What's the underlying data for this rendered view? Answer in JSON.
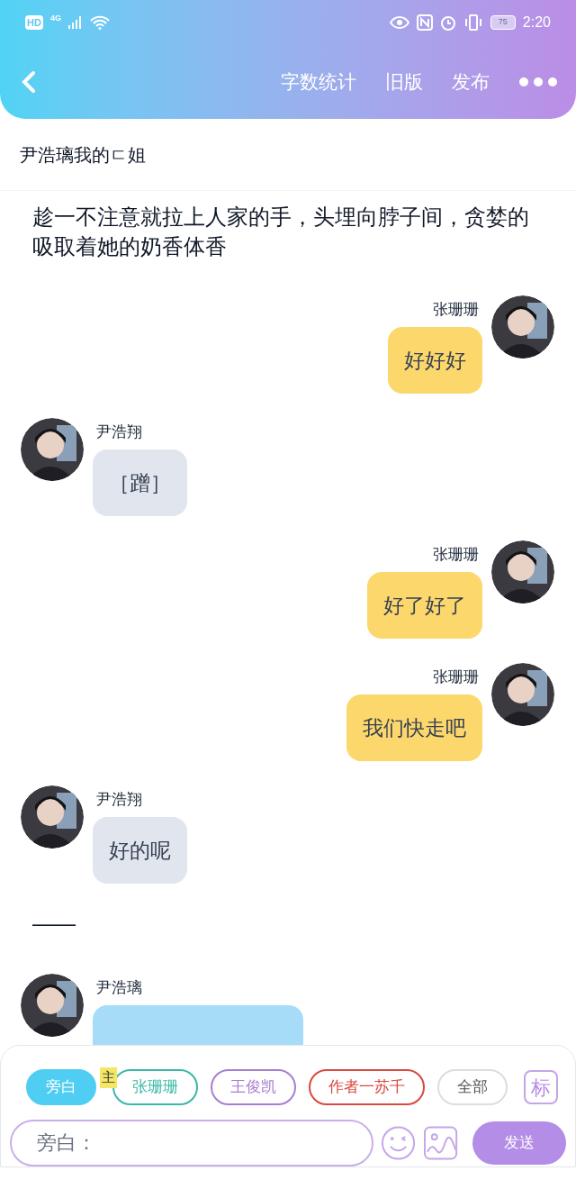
{
  "status_bar": {
    "hd": "HD",
    "network": "4G",
    "battery": "75",
    "time": "2:20"
  },
  "header": {
    "actions": [
      "字数统计",
      "旧版",
      "发布"
    ]
  },
  "chapter_title": "尹浩璃我的ㄷ姐",
  "messages": [
    {
      "kind": "narration",
      "text": "趁一不注意就拉上人家的手，头埋向脖子间，贪婪的吸取着她的奶香体香"
    },
    {
      "kind": "right",
      "speaker": "张珊珊",
      "text": "好好好",
      "color": "#fcd76b"
    },
    {
      "kind": "left",
      "speaker": "尹浩翔",
      "text": "［蹭］",
      "color": "#e1e6ee"
    },
    {
      "kind": "right",
      "speaker": "张珊珊",
      "text": "好了好了",
      "color": "#fcd76b"
    },
    {
      "kind": "right",
      "speaker": "张珊珊",
      "text": "我们快走吧",
      "color": "#fcd76b"
    },
    {
      "kind": "left",
      "speaker": "尹浩翔",
      "text": "好的呢",
      "color": "#e1e6ee"
    },
    {
      "kind": "narration",
      "text": "——"
    },
    {
      "kind": "left",
      "speaker": "尹浩璃",
      "color": "#a6dcf8"
    }
  ],
  "role_chips": [
    {
      "label": "旁白",
      "color": "#4fcdf2",
      "selected": true
    },
    {
      "label": "张珊珊",
      "color": "#3bb8a5",
      "selected": false,
      "badge": "主"
    },
    {
      "label": "王俊凯",
      "color": "#a87fd0",
      "selected": false
    },
    {
      "label": "作者一苏千",
      "color": "#d9493f",
      "selected": false
    },
    {
      "label": "全部",
      "color": "#555555",
      "selected": false
    }
  ],
  "mark_button": "标",
  "input": {
    "placeholder": "旁白："
  },
  "send_button": "发送"
}
